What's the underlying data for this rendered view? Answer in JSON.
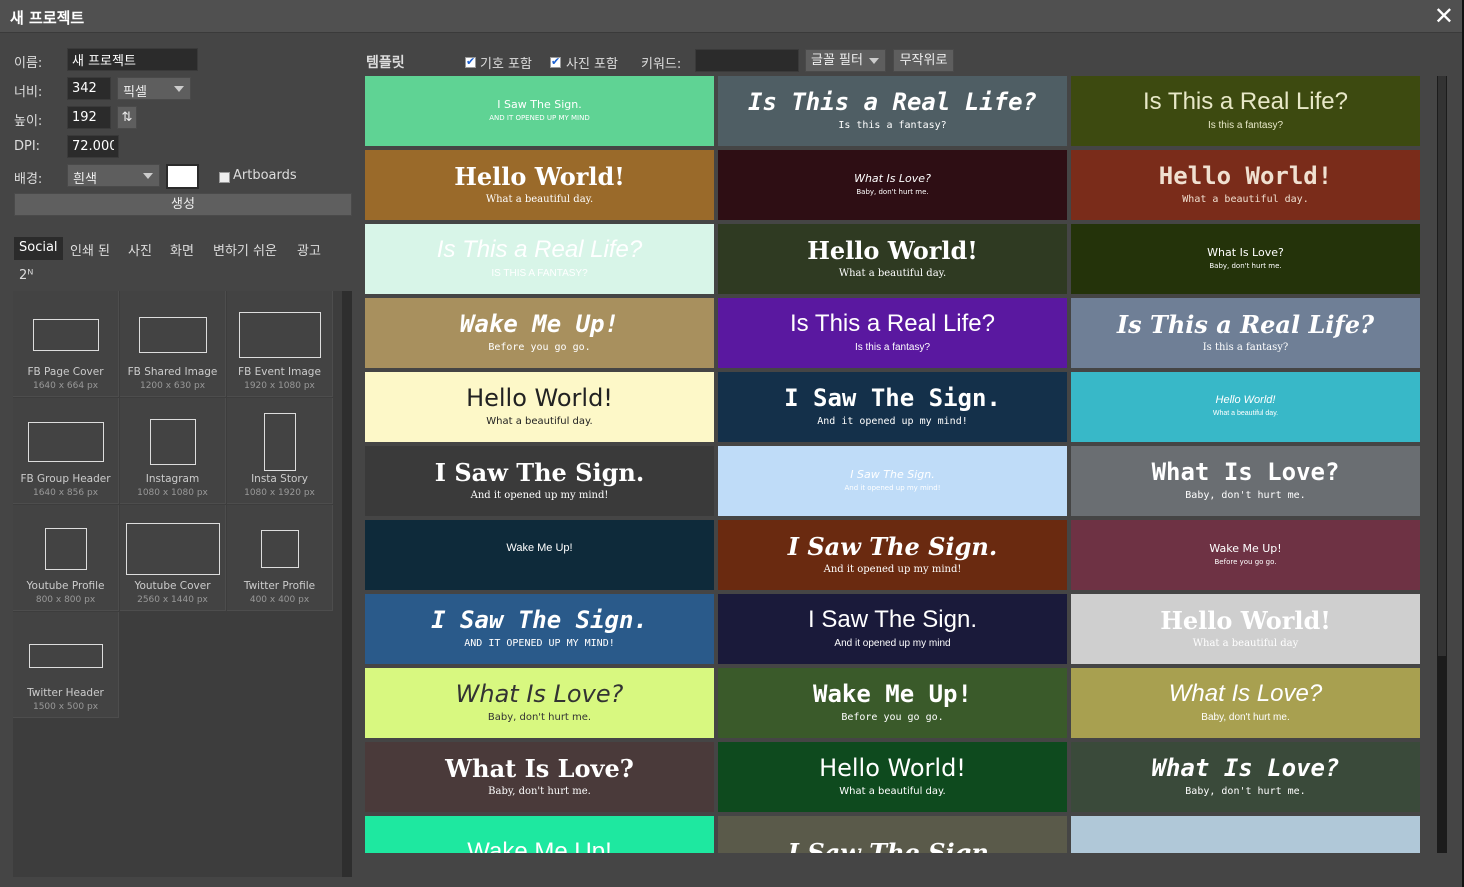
{
  "dialog": {
    "title": "새 프로젝트",
    "close_glyph": "✕"
  },
  "form": {
    "name_label": "이름:",
    "name_value": "새 프로젝트",
    "width_label": "너비:",
    "width_value": "342",
    "unit_value": "픽셀",
    "height_label": "높이:",
    "height_value": "192",
    "swap_glyph": "⇅",
    "dpi_label": "DPI:",
    "dpi_value": "72.000",
    "bg_label": "배경:",
    "bg_value": "흰색",
    "bg_swatch": "#ffffff",
    "artboards_label": "Artboards",
    "create_label": "생성"
  },
  "tabs": [
    {
      "label": "Social"
    },
    {
      "label": "인쇄 된"
    },
    {
      "label": "사진"
    },
    {
      "label": "화면"
    },
    {
      "label": "변하기 쉬운"
    },
    {
      "label": "광고"
    },
    {
      "label": "2ᴺ"
    }
  ],
  "presets": [
    {
      "name": "FB Page Cover",
      "size": "1640 x 664 px"
    },
    {
      "name": "FB Shared Image",
      "size": "1200 x 630 px"
    },
    {
      "name": "FB Event Image",
      "size": "1920 x 1080 px"
    },
    {
      "name": "FB Group Header",
      "size": "1640 x 856 px"
    },
    {
      "name": "Instagram",
      "size": "1080 x 1080 px"
    },
    {
      "name": "Insta Story",
      "size": "1080 x 1920 px"
    },
    {
      "name": "Youtube Profile",
      "size": "800 x 800 px"
    },
    {
      "name": "Youtube Cover",
      "size": "2560 x 1440 px"
    },
    {
      "name": "Twitter Profile",
      "size": "400 x 400 px"
    },
    {
      "name": "Twitter Header",
      "size": "1500 x 500 px"
    }
  ],
  "template_bar": {
    "title": "템플릿",
    "include_symbols": "기호 포함",
    "include_photos": "사진 포함",
    "keyword_label": "키워드:",
    "keyword_value": "",
    "font_filter": "글꼴 필터",
    "random": "무작위로"
  },
  "templates": [
    {
      "title": "I Saw The Sign.",
      "sub": "AND IT OPENED UP MY MIND",
      "bg": "#5fd394",
      "fg": "#ffffff"
    },
    {
      "title": "Is This a Real Life?",
      "sub": "Is this a fantasy?",
      "bg": "#4f5e64",
      "fg": "#ffffff"
    },
    {
      "title": "Is This a Real Life?",
      "sub": "Is this a fantasy?",
      "bg": "#3d4a10",
      "fg": "#e8e8c8"
    },
    {
      "title": "Hello World!",
      "sub": "What a beautiful day.",
      "bg": "#9a6a2a",
      "fg": "#ffffff"
    },
    {
      "title": "What Is Love?",
      "sub": "Baby, don't hurt me.",
      "bg": "#2e0e14",
      "fg": "#ffffff"
    },
    {
      "title": "Hello World!",
      "sub": "What a beautiful day.",
      "bg": "#7a2c1a",
      "fg": "#f0e0d0"
    },
    {
      "title": "Is This a Real Life?",
      "sub": "IS THIS A FANTASY?",
      "bg": "#d8f5e8",
      "fg": "#ffffff"
    },
    {
      "title": "Hello World!",
      "sub": "What a beautiful day.",
      "bg": "#2f3a22",
      "fg": "#ffffff"
    },
    {
      "title": "What Is Love?",
      "sub": "Baby, don't hurt me.",
      "bg": "#24330a",
      "fg": "#ffffff"
    },
    {
      "title": "Wake Me Up!",
      "sub": "Before you go go.",
      "bg": "#a8905e",
      "fg": "#ffffff"
    },
    {
      "title": "Is This a Real Life?",
      "sub": "Is this a fantasy?",
      "bg": "#5a18a0",
      "fg": "#ffffff"
    },
    {
      "title": "Is This a Real Life?",
      "sub": "Is this a fantasy?",
      "bg": "#6f7f96",
      "fg": "#ffffff"
    },
    {
      "title": "Hello World!",
      "sub": "What a beautiful day.",
      "bg": "#fdf8c8",
      "fg": "#222222"
    },
    {
      "title": "I Saw The Sign.",
      "sub": "And it opened up my mind!",
      "bg": "#14304a",
      "fg": "#ffffff"
    },
    {
      "title": "Hello World!",
      "sub": "What a beautiful day.",
      "bg": "#38b8c8",
      "fg": "#ffffff"
    },
    {
      "title": "I Saw The Sign.",
      "sub": "And it opened up my mind!",
      "bg": "#3a3a3a",
      "fg": "#ffffff"
    },
    {
      "title": "I Saw The Sign.",
      "sub": "And it opened up my mind!",
      "bg": "#bfdcf8",
      "fg": "#ffffff"
    },
    {
      "title": "What Is Love?",
      "sub": "Baby, don't hurt me.",
      "bg": "#6a6e72",
      "fg": "#ffffff"
    },
    {
      "title": "Wake Me Up!",
      "sub": "",
      "bg": "#0e2a3a",
      "fg": "#ffffff"
    },
    {
      "title": "I Saw The Sign.",
      "sub": "And it opened up my mind!",
      "bg": "#6a2a10",
      "fg": "#ffffff"
    },
    {
      "title": "Wake Me Up!",
      "sub": "Before you go go.",
      "bg": "#6e3244",
      "fg": "#ffffff"
    },
    {
      "title": "I Saw The Sign.",
      "sub": "AND IT OPENED UP MY MIND!",
      "bg": "#2a5a8a",
      "fg": "#ffffff"
    },
    {
      "title": "I Saw The Sign.",
      "sub": "And it opened up my mind",
      "bg": "#1a1a3a",
      "fg": "#ffffff"
    },
    {
      "title": "Hello World!",
      "sub": "What a beautiful day",
      "bg": "#cfcfcf",
      "fg": "#ffffff"
    },
    {
      "title": "What Is Love?",
      "sub": "Baby, don't hurt me.",
      "bg": "#d8f880",
      "fg": "#333333"
    },
    {
      "title": "Wake Me Up!",
      "sub": "Before you go go.",
      "bg": "#3a5a2a",
      "fg": "#ffffff"
    },
    {
      "title": "What Is Love?",
      "sub": "Baby, don't hurt me.",
      "bg": "#a8a050",
      "fg": "#ffffff"
    },
    {
      "title": "What Is Love?",
      "sub": "Baby, don't hurt me.",
      "bg": "#4a3a3a",
      "fg": "#ffffff"
    },
    {
      "title": "Hello World!",
      "sub": "What a beautiful day.",
      "bg": "#0e4a1e",
      "fg": "#ffffff"
    },
    {
      "title": "What Is Love?",
      "sub": "Baby, don't hurt me.",
      "bg": "#3a4a3a",
      "fg": "#ffffff"
    },
    {
      "title": "Wake Me Up!",
      "sub": "",
      "bg": "#1ee8a0",
      "fg": "#ffffff"
    },
    {
      "title": "I Saw The Sign.",
      "sub": "",
      "bg": "#5a5a4a",
      "fg": "#ffffff"
    },
    {
      "title": "",
      "sub": "",
      "bg": "#b0c8d8",
      "fg": "#ffffff"
    }
  ]
}
